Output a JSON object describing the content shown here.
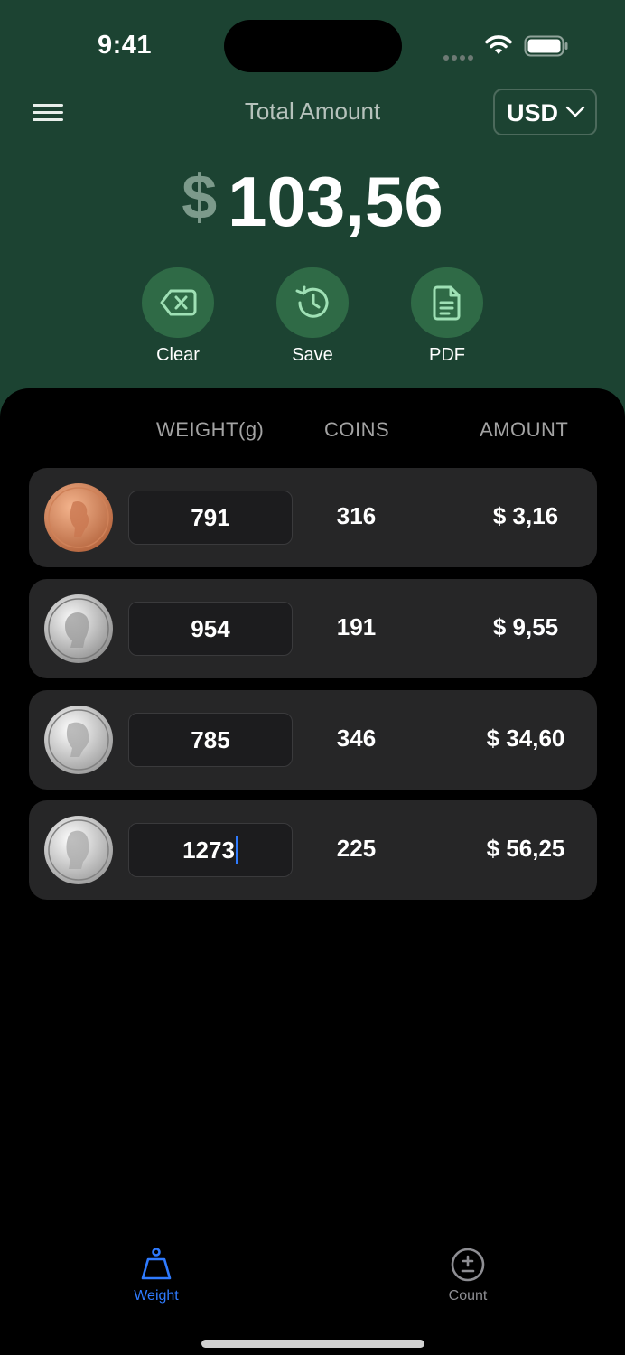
{
  "status_bar": {
    "time": "9:41"
  },
  "header": {
    "title": "Total Amount",
    "currency": "USD",
    "total_symbol": "$",
    "total_value": "103,56"
  },
  "actions": [
    {
      "label": "Clear",
      "icon": "clear-icon"
    },
    {
      "label": "Save",
      "icon": "history-icon"
    },
    {
      "label": "PDF",
      "icon": "document-icon"
    }
  ],
  "table": {
    "columns": [
      "WEIGHT(g)",
      "COINS",
      "AMOUNT"
    ],
    "rows": [
      {
        "coin": "penny",
        "weight": "791",
        "coins": "316",
        "amount": "$ 3,16"
      },
      {
        "coin": "nickel",
        "weight": "954",
        "coins": "191",
        "amount": "$ 9,55"
      },
      {
        "coin": "dime",
        "weight": "785",
        "coins": "346",
        "amount": "$ 34,60"
      },
      {
        "coin": "quarter",
        "weight": "1273",
        "coins": "225",
        "amount": "$ 56,25"
      }
    ]
  },
  "tab_bar": {
    "items": [
      {
        "label": "Weight",
        "icon": "weight-icon",
        "active": true
      },
      {
        "label": "Count",
        "icon": "plus-minus-icon",
        "active": false
      }
    ]
  },
  "colors": {
    "header_bg": "#1c4332",
    "action_bg": "#2f6a46",
    "accent_blue": "#2f7bff",
    "row_bg": "#262627"
  }
}
